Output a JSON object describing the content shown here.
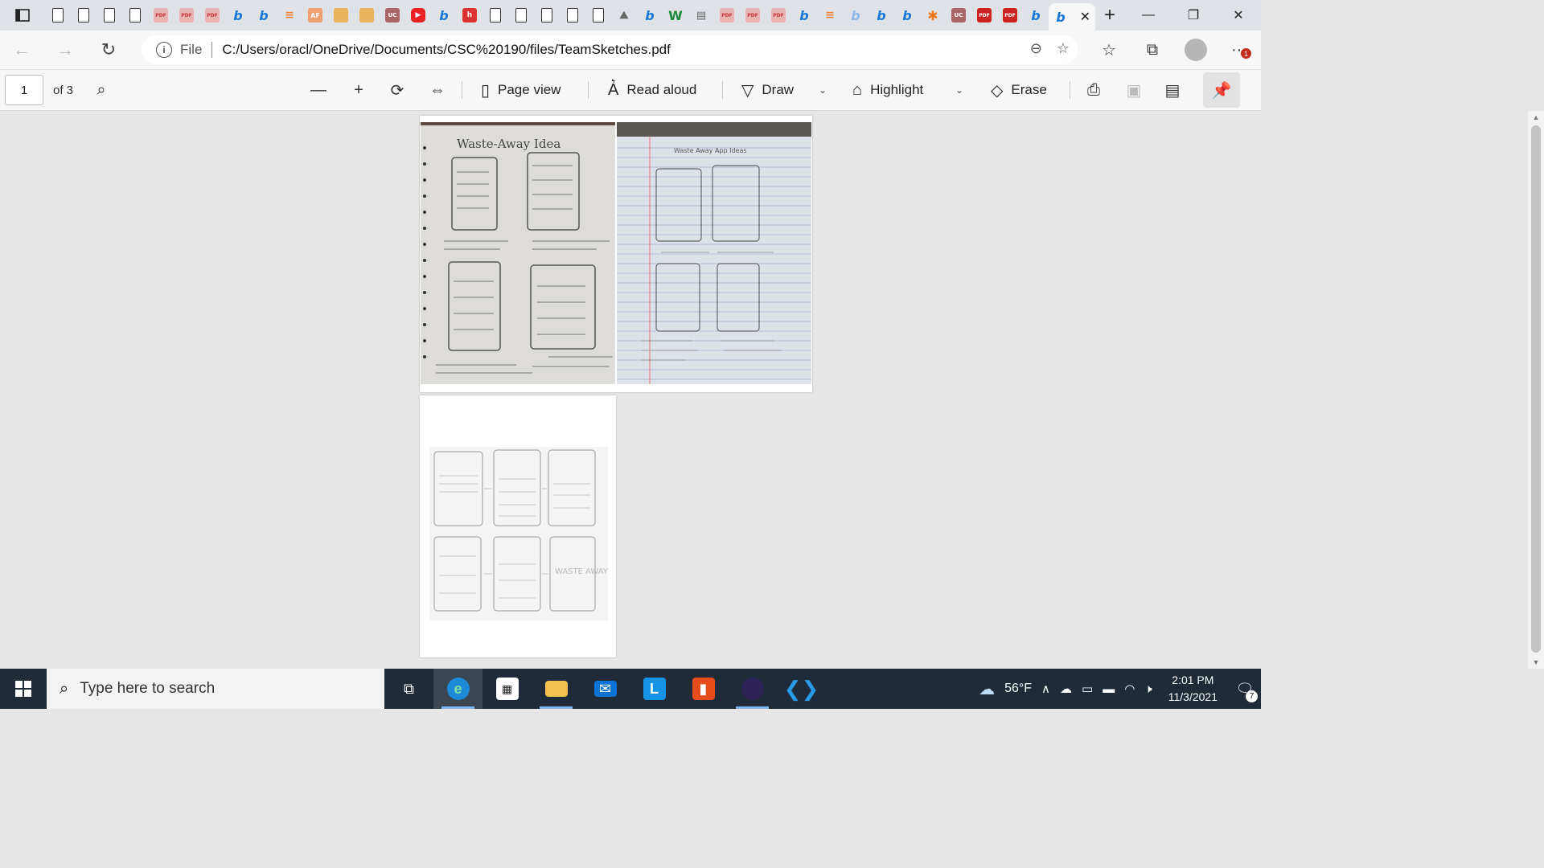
{
  "browser": {
    "tab_favicons": [
      "doc",
      "doc",
      "doc",
      "doc",
      "pdf",
      "pdf",
      "pdf",
      "bing",
      "bing",
      "so",
      "af",
      "note",
      "note",
      "uc",
      "yt",
      "bing",
      "h",
      "doc",
      "doc",
      "doc",
      "doc",
      "doc",
      "img",
      "bing",
      "w",
      "gray",
      "pdf",
      "pdf",
      "pdf",
      "bing",
      "so",
      "bing-light",
      "bing",
      "bing",
      "orange",
      "uc",
      "pdfred",
      "pdfred",
      "bing"
    ],
    "fav_text": {
      "pdf": "PDF",
      "af": "AF",
      "uc": "UC",
      "h": "h",
      "w": "W",
      "bing": "b",
      "yt": "▶"
    },
    "address": {
      "scheme_label": "File",
      "url": "C:/Users/oracl/OneDrive/Documents/CSC%20190/files/TeamSketches.pdf"
    },
    "badge_count": "1"
  },
  "pdf_toolbar": {
    "page_current": "1",
    "page_total_label": "of 3",
    "page_view_label": "Page view",
    "read_aloud_label": "Read aloud",
    "draw_label": "Draw",
    "highlight_label": "Highlight",
    "erase_label": "Erase"
  },
  "pages": [
    {
      "photo_1_title": "Waste-Away Idea",
      "photo_2_title": "Waste Away App Ideas"
    },
    {
      "brand_text": "WASTE AWAY"
    }
  ],
  "taskbar": {
    "search_placeholder": "Type here to search",
    "weather": "56°F",
    "time": "2:01 PM",
    "date": "11/3/2021",
    "notifications": "7"
  },
  "colors": {
    "taskbar": "#1f2b38",
    "accent": "#0078d4"
  }
}
